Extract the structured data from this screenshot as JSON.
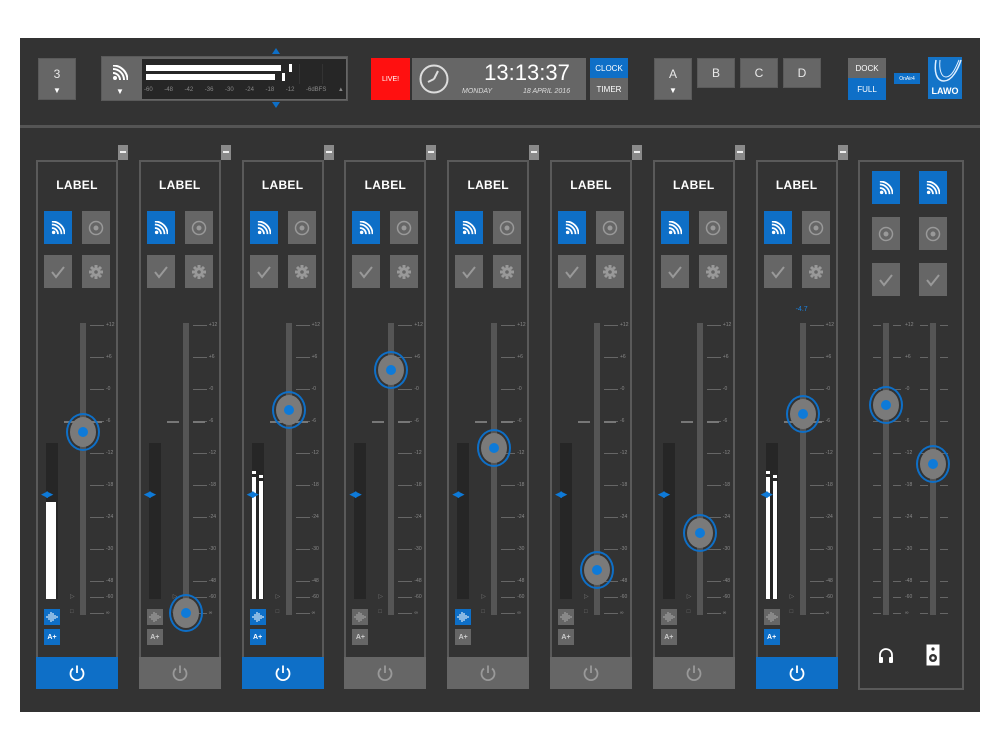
{
  "header": {
    "bank_selector": {
      "value": "3"
    },
    "source_meter": {
      "scale": [
        "-60",
        "-48",
        "-42",
        "-36",
        "-30",
        "-24",
        "-18",
        "-12",
        "-6dBFS"
      ],
      "left_level_db": -17,
      "right_level_db": -18,
      "left_peak_db": -14,
      "right_peak_db": -16
    },
    "live_label": "LIVE!",
    "clock": {
      "time": "13:13:37",
      "day": "MONDAY",
      "date": "18 APRIL 2016"
    },
    "clock_mode": {
      "clock_label": "CLOCK",
      "timer_label": "TIMER",
      "active": "CLOCK"
    },
    "layers": [
      {
        "label": "A",
        "has_dropdown": true
      },
      {
        "label": "B"
      },
      {
        "label": "C"
      },
      {
        "label": "D"
      }
    ],
    "view_mode": {
      "dock_label": "DOCK",
      "full_label": "FULL",
      "active": "FULL"
    },
    "product_badge": "OnAir4",
    "logo_text": "LAWO"
  },
  "fader_scale": [
    "+12",
    "+6",
    "-0",
    "-6",
    "-12",
    "-18",
    "-24",
    "-30",
    "-48",
    "-60",
    "∞"
  ],
  "channels": [
    {
      "label": "LABEL",
      "gain_db": -8,
      "on": true,
      "pfl": false,
      "meter": "single",
      "meter_level": 0.62,
      "peak": null,
      "voice_on": true,
      "agc_on": true
    },
    {
      "label": "LABEL",
      "gain_db": "-inf",
      "on": false,
      "pfl": false,
      "meter": "none",
      "meter_level": 0,
      "peak": null,
      "voice_on": false,
      "agc_on": false
    },
    {
      "label": "LABEL",
      "gain_db": -4,
      "on": true,
      "pfl": false,
      "meter": "stereo",
      "meter_level": 0.78,
      "peak": 0.82,
      "voice_on": true,
      "agc_on": true
    },
    {
      "label": "LABEL",
      "gain_db": 3.5,
      "on": false,
      "pfl": false,
      "meter": "none",
      "meter_level": 0,
      "peak": null,
      "voice_on": false,
      "agc_on": false
    },
    {
      "label": "LABEL",
      "gain_db": -11,
      "on": false,
      "pfl": false,
      "meter": "none",
      "meter_level": 0,
      "peak": null,
      "voice_on": true,
      "agc_on": false
    },
    {
      "label": "LABEL",
      "gain_db": -42,
      "on": false,
      "pfl": false,
      "meter": "none",
      "meter_level": 0,
      "peak": null,
      "voice_on": false,
      "agc_on": false
    },
    {
      "label": "LABEL",
      "gain_db": -27,
      "on": false,
      "pfl": false,
      "meter": "none",
      "meter_level": 0,
      "peak": null,
      "voice_on": false,
      "agc_on": false
    },
    {
      "label": "LABEL",
      "gain_db": -4.7,
      "gain_readout": "-4.7",
      "on": true,
      "pfl": false,
      "meter": "stereo",
      "meter_level": 0.78,
      "peak": 0.82,
      "voice_on": false,
      "agc_on": true
    }
  ],
  "monitor": {
    "left": {
      "gain_db": -3,
      "icon": "headphones-icon"
    },
    "right": {
      "gain_db": -14,
      "icon": "speaker-icon"
    }
  }
}
